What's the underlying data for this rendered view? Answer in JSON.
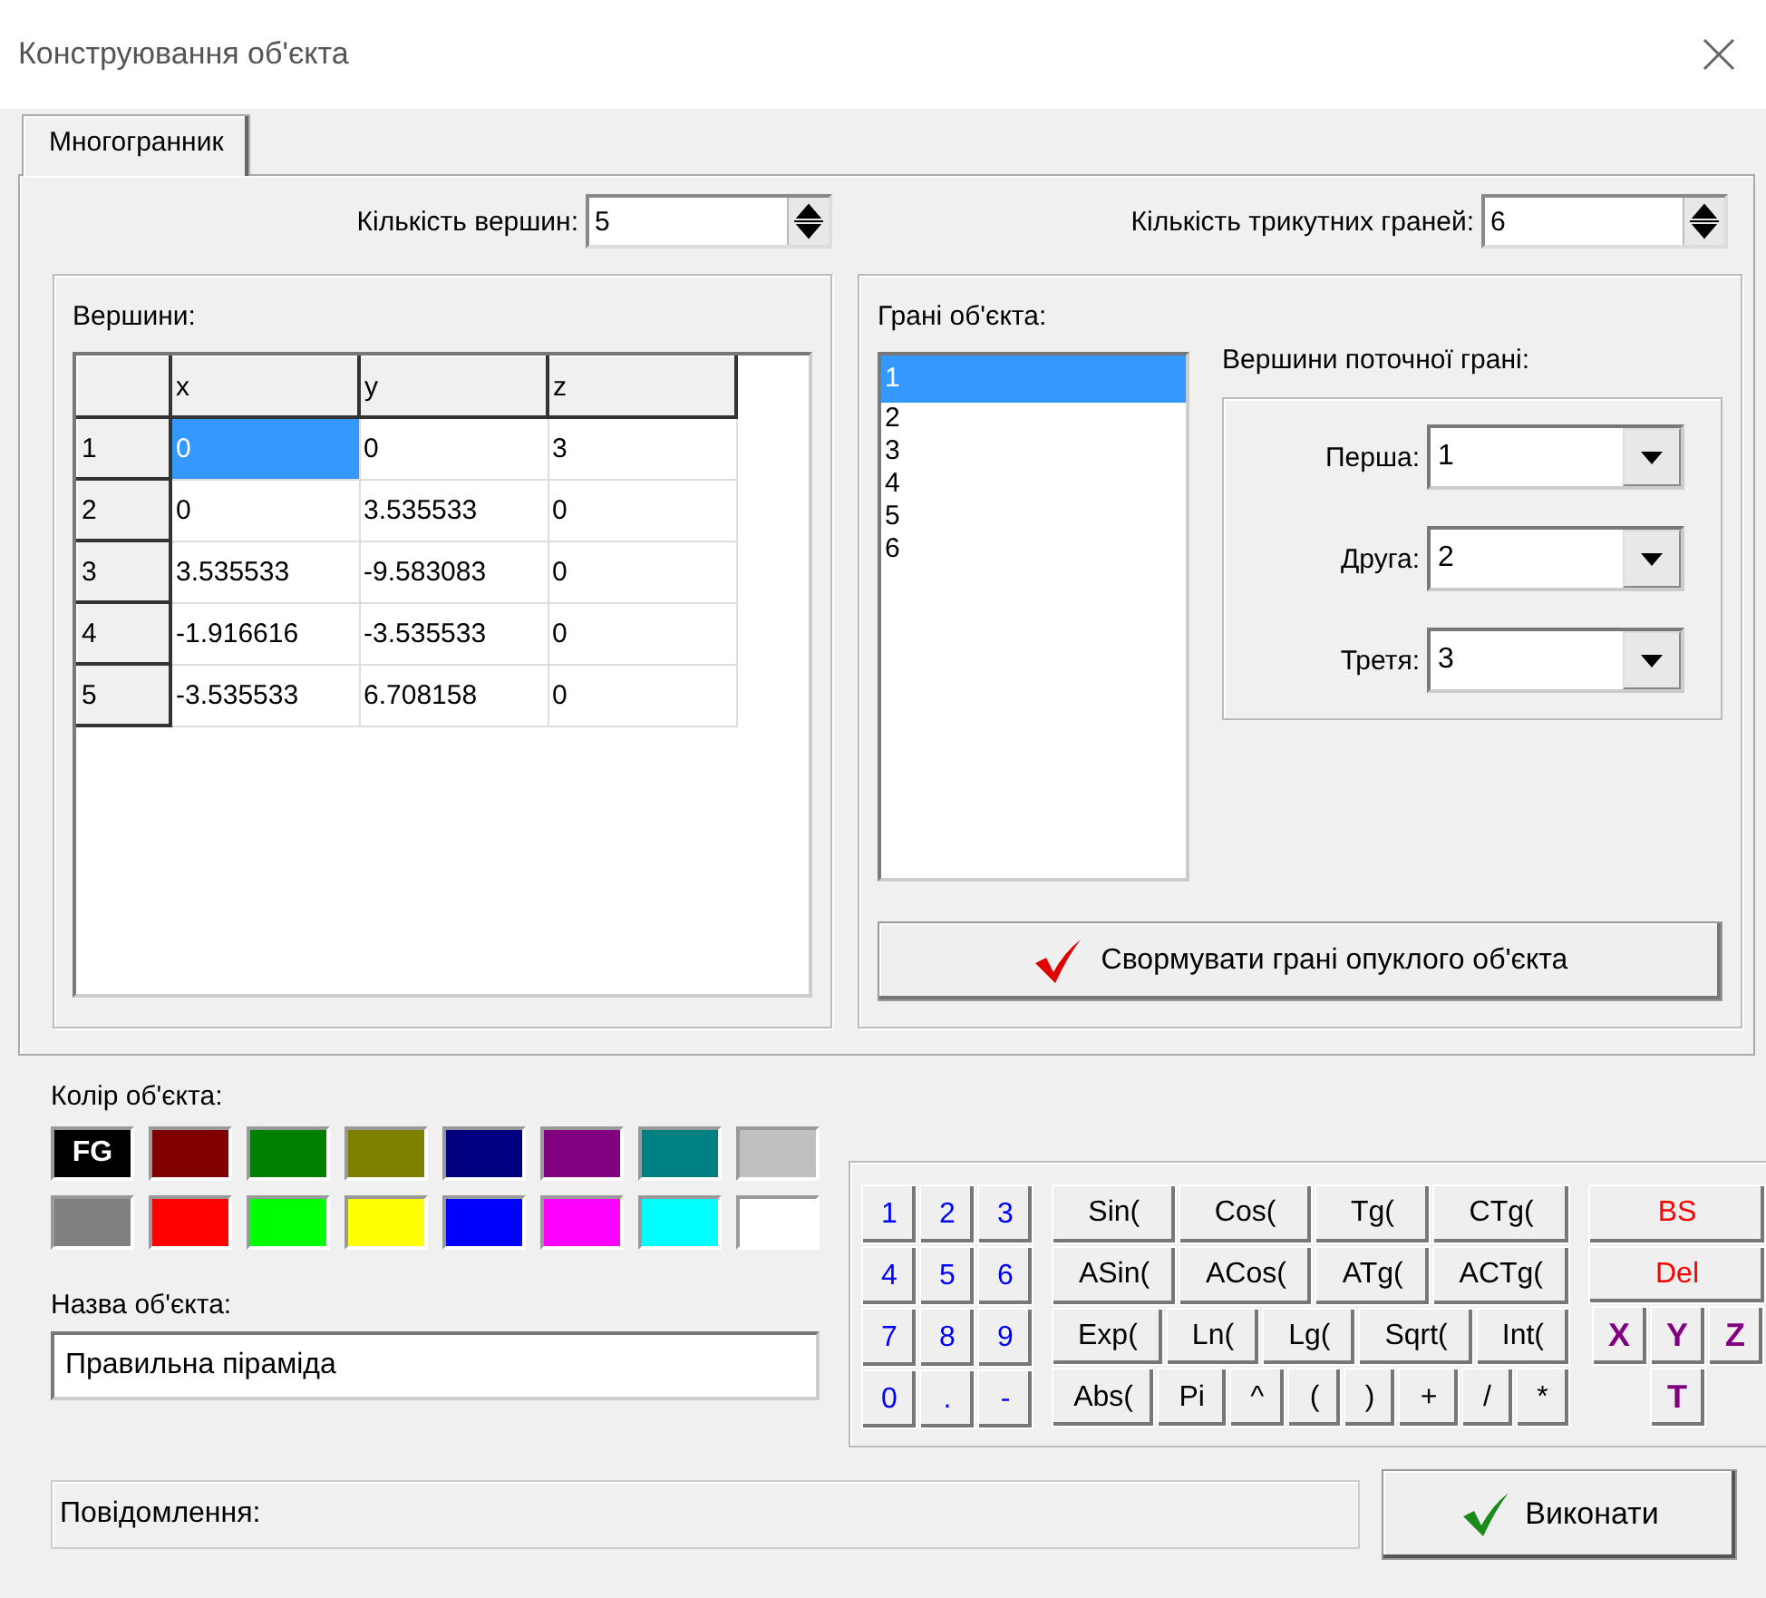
{
  "window": {
    "title": "Конструювання об'єкта"
  },
  "tabs": [
    {
      "label": "Многогранник",
      "selected": true
    }
  ],
  "vertex_count": {
    "label": "Кількість вершин:",
    "value": "5"
  },
  "face_count": {
    "label": "Кількість трикутних граней:",
    "value": "6"
  },
  "vertices": {
    "title": "Вершини:",
    "columns": [
      "x",
      "y",
      "z"
    ],
    "rows": [
      {
        "header": "1",
        "cells": [
          {
            "text": "0",
            "selected": true
          },
          {
            "text": "0",
            "selected": false
          },
          {
            "text": "3",
            "selected": false
          }
        ]
      },
      {
        "header": "2",
        "cells": [
          {
            "text": "0",
            "selected": false
          },
          {
            "text": "3.535533",
            "selected": false
          },
          {
            "text": "0",
            "selected": false
          }
        ]
      },
      {
        "header": "3",
        "cells": [
          {
            "text": "3.535533",
            "selected": false
          },
          {
            "text": "-9.583083",
            "selected": false
          },
          {
            "text": "0",
            "selected": false
          }
        ]
      },
      {
        "header": "4",
        "cells": [
          {
            "text": "-1.916616",
            "selected": false
          },
          {
            "text": "-3.535533",
            "selected": false
          },
          {
            "text": "0",
            "selected": false
          }
        ]
      },
      {
        "header": "5",
        "cells": [
          {
            "text": "-3.535533",
            "selected": false
          },
          {
            "text": "6.708158",
            "selected": false
          },
          {
            "text": "0",
            "selected": false
          }
        ]
      }
    ]
  },
  "faces": {
    "title": "Грані об'єкта:",
    "items": [
      {
        "label": "1",
        "selected": true
      },
      {
        "label": "2",
        "selected": false
      },
      {
        "label": "3",
        "selected": false
      },
      {
        "label": "4",
        "selected": false
      },
      {
        "label": "5",
        "selected": false
      },
      {
        "label": "6",
        "selected": false
      }
    ]
  },
  "current_face": {
    "title": "Вершини поточної грані:",
    "fields": [
      {
        "label": "Перша:",
        "value": "1"
      },
      {
        "label": "Друга:",
        "value": "2"
      },
      {
        "label": "Третя:",
        "value": "3"
      }
    ]
  },
  "form_button": {
    "label": "Свормувати грані опуклого об'єкта"
  },
  "color": {
    "title": "Колір об'єкта:",
    "swatches": [
      {
        "color": "#000000",
        "label": "FG"
      },
      {
        "color": "#800000"
      },
      {
        "color": "#008000"
      },
      {
        "color": "#808000"
      },
      {
        "color": "#000080"
      },
      {
        "color": "#800080"
      },
      {
        "color": "#008080"
      },
      {
        "color": "#c0c0c0"
      },
      {
        "color": "#808080"
      },
      {
        "color": "#ff0000"
      },
      {
        "color": "#00ff00"
      },
      {
        "color": "#ffff00"
      },
      {
        "color": "#0000ff"
      },
      {
        "color": "#ff00ff"
      },
      {
        "color": "#00ffff"
      },
      {
        "color": "#ffffff"
      }
    ]
  },
  "name": {
    "label": "Назва об'єкта:",
    "value": "Правильна піраміда"
  },
  "keypad": {
    "digits": [
      "1",
      "2",
      "3",
      "4",
      "5",
      "6",
      "7",
      "8",
      "9",
      "0",
      ".",
      "-"
    ],
    "functions": [
      [
        "Sin(",
        "Cos(",
        "Tg(",
        "CTg("
      ],
      [
        "ASin(",
        "ACos(",
        "ATg(",
        "ACTg("
      ],
      [
        "Exp(",
        "Ln(",
        "Lg(",
        "Sqrt(",
        "Int("
      ],
      [
        "Abs(",
        "Pi",
        "^",
        "(",
        ")",
        "+",
        "/",
        "*"
      ]
    ],
    "edit": [
      "BS",
      "Del"
    ],
    "variables": [
      "X",
      "Y",
      "Z",
      "T"
    ]
  },
  "message": {
    "label": "Повідомлення:"
  },
  "execute_button": {
    "label": "Виконати"
  }
}
